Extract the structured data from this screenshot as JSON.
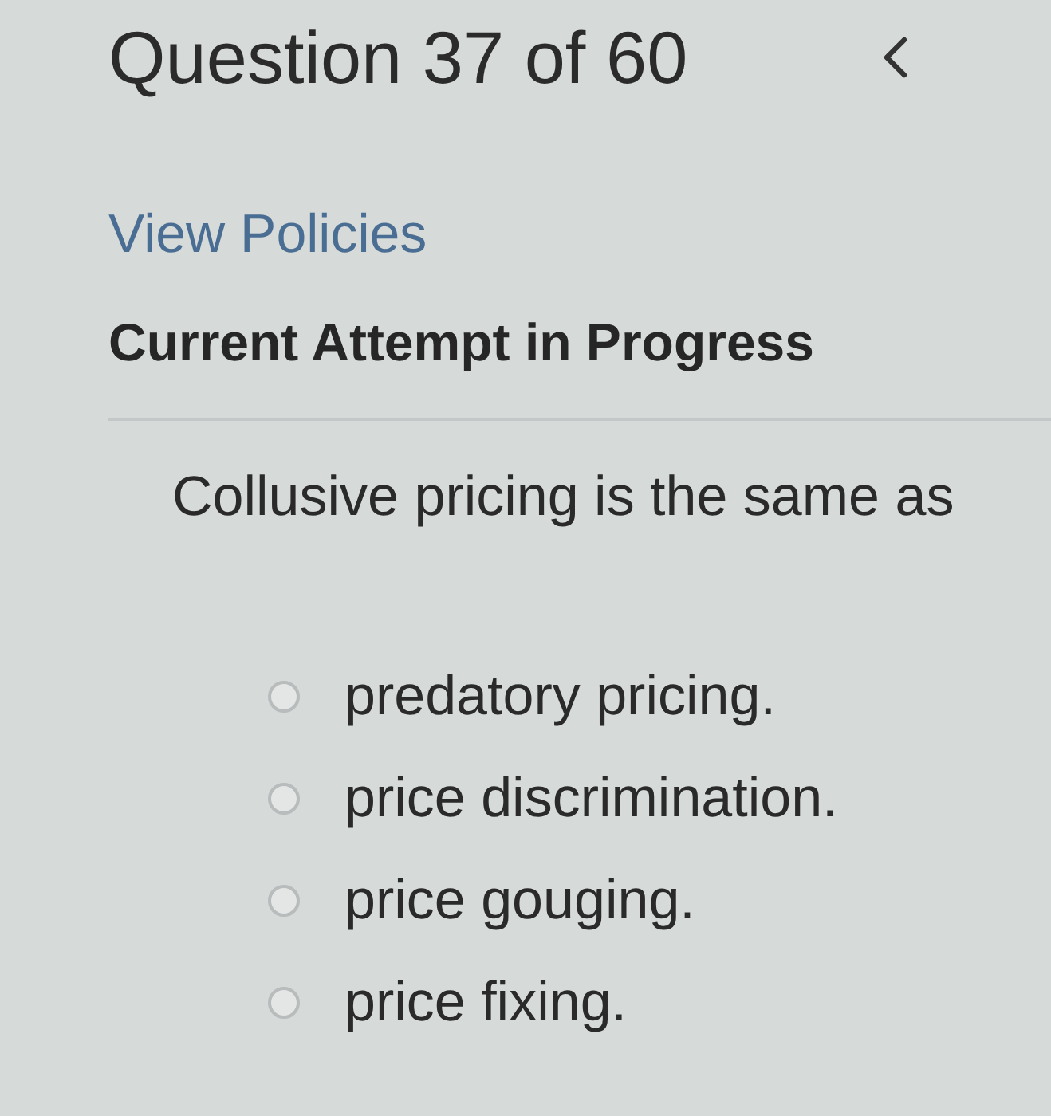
{
  "header": {
    "title": "Question 37 of 60"
  },
  "policies_link": "View Policies",
  "attempt_status": "Current Attempt in Progress",
  "question": {
    "prompt": "Collusive pricing is the same as",
    "options": [
      {
        "label": "predatory pricing.",
        "selected": false
      },
      {
        "label": "price discrimination.",
        "selected": false
      },
      {
        "label": "price gouging.",
        "selected": false
      },
      {
        "label": "price fixing.",
        "selected": false
      }
    ]
  }
}
